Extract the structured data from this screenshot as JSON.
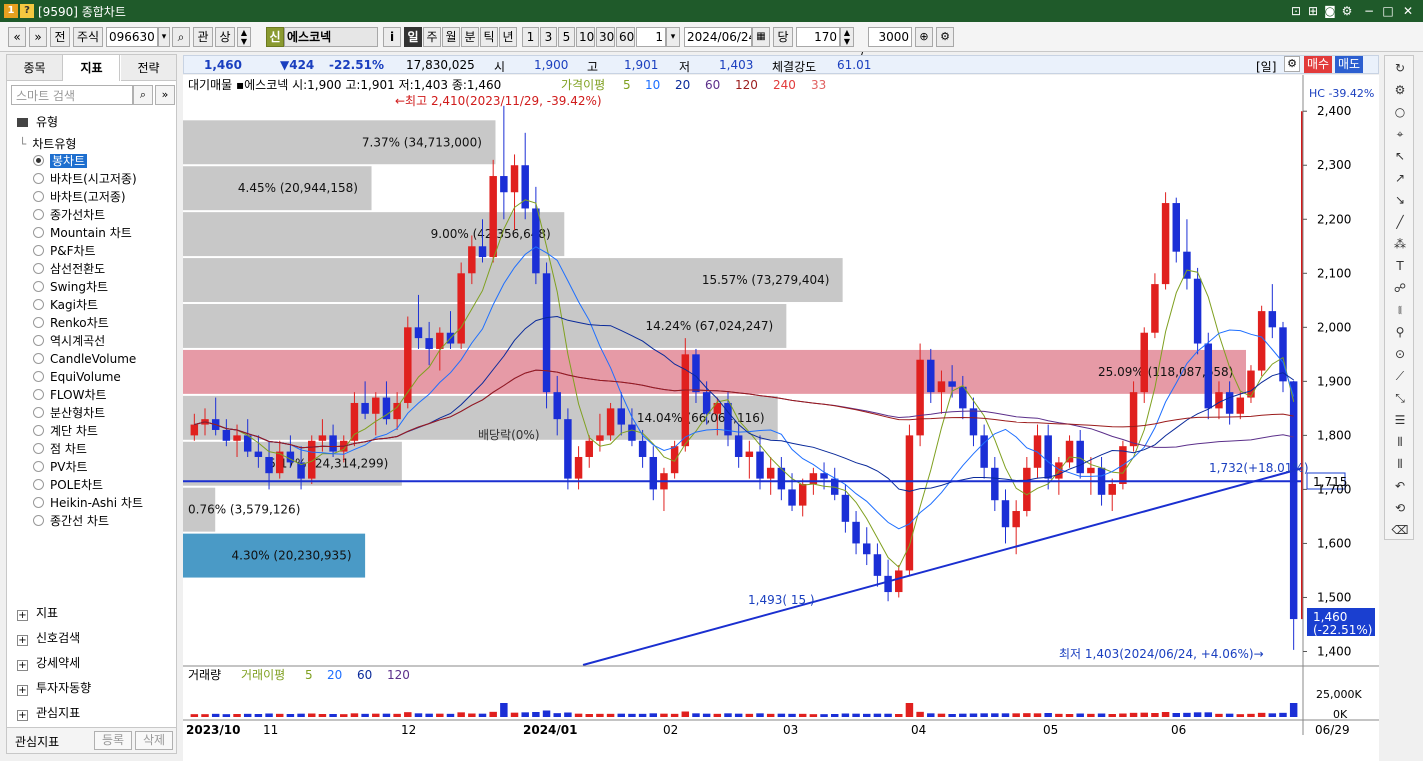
{
  "window": {
    "title": "[9590] 종합차트",
    "icon1": "1",
    "icon2": "?"
  },
  "toolbar": {
    "nav_prev": "«",
    "nav_down": "»",
    "jeon": "전",
    "market": "주식",
    "code": "096630",
    "search_icon": "⌕",
    "gwan": "관",
    "sang": "상",
    "sin_badge": "신",
    "stock_name": "에스코넥",
    "info_btn": "i",
    "periods": [
      "일",
      "주",
      "월",
      "분",
      "틱",
      "년"
    ],
    "selected_period": "일",
    "intervals": [
      "1",
      "3",
      "5",
      "10",
      "30",
      "60"
    ],
    "period_count": "1",
    "date": "2024/06/24",
    "dang": "당",
    "count": "170",
    "slash": "/",
    "total": "3000"
  },
  "left_panel": {
    "tabs": [
      "종목",
      "지표",
      "전략"
    ],
    "selected_tab": "지표",
    "search_placeholder": "스마트 검색",
    "section_type": "유형",
    "chart_type_header": "차트유형",
    "chart_types": [
      "봉차트",
      "바차트(시고저종)",
      "바차트(고저종)",
      "종가선차트",
      "Mountain 차트",
      "P&F차트",
      "삼선전환도",
      "Swing차트",
      "Kagi차트",
      "Renko차트",
      "역시계곡선",
      "CandleVolume",
      "EquiVolume",
      "FLOW차트",
      "분산형차트",
      "계단 차트",
      "점 차트",
      "PV차트",
      "POLE차트",
      "Heikin-Ashi 차트",
      "종간선 차트"
    ],
    "selected_chart_type": "봉차트",
    "sections": [
      "지표",
      "신호검색",
      "강세약세",
      "투자자동향",
      "관심지표"
    ],
    "bottom_label": "관심지표",
    "register_btn": "등록",
    "delete_btn": "삭제"
  },
  "info_bar": {
    "price": "1,460",
    "change": "▼424",
    "change_pct": "-22.51%",
    "volume": "17,830,025",
    "open_label": "시",
    "open": "1,900",
    "high_label": "고",
    "high": "1,901",
    "low_label": "저",
    "low": "1,403",
    "strength_label": "체결강도",
    "strength": "61.01",
    "period_tag": "[일]",
    "buy": "매수",
    "sell": "매도"
  },
  "chart_data": {
    "type": "candlestick",
    "stock": "에스코넥",
    "legend": "대기매물 ▪에스코넥 시:1,900 고:1,901 저:1,403 종:1,460",
    "ma_label": "가격이평",
    "ma_periods": [
      "5",
      "10",
      "20",
      "60",
      "120",
      "240",
      "33"
    ],
    "ma_colors": [
      "#7fa020",
      "#1e6fff",
      "#0a2a9a",
      "#5b2f8a",
      "#9b1b1b",
      "#e23b3b",
      "#e06060"
    ],
    "y_ticks": [
      "2,400",
      "2,300",
      "2,200",
      "2,100",
      "2,000",
      "1,900",
      "1,800",
      "1,700",
      "1,600",
      "1,500",
      "1,400"
    ],
    "ylim": [
      1375,
      2430
    ],
    "x_labels": [
      "2023/10",
      "11",
      "12",
      "2024/01",
      "02",
      "03",
      "04",
      "05",
      "06",
      "06/29"
    ],
    "volume_panel": {
      "label": "거래량",
      "ma_label": "거래이평",
      "ma_periods": [
        "5",
        "20",
        "60",
        "120"
      ],
      "ticks": [
        "25,000K",
        "0K"
      ]
    },
    "annotations": {
      "high": "←최고 2,410(2023/11/29, -39.42%)",
      "low": "최저 1,403(2024/06/24, +4.06%)→",
      "hc": "HC -39.42%",
      "last_price": "1,460",
      "last_pct": "(-22.51%)",
      "line_price": "1,715",
      "trend_label": "1,732(+18.01%)",
      "low_label": "1,493(  15  )",
      "dividend": "배당락(0%)"
    },
    "volume_profile": [
      {
        "pct": "7.37% (34,713,000)",
        "value": 34713000,
        "low": 2300,
        "high": 2385
      },
      {
        "pct": "4.45% (20,944,158)",
        "value": 20944158,
        "low": 2215,
        "high": 2300
      },
      {
        "pct": "9.00% (42,356,648)",
        "value": 42356648,
        "low": 2130,
        "high": 2215
      },
      {
        "pct": "15.57% (73,279,404)",
        "value": 73279404,
        "low": 2045,
        "high": 2130
      },
      {
        "pct": "14.24% (67,024,247)",
        "value": 67024247,
        "low": 1960,
        "high": 2045
      },
      {
        "pct": "25.09% (118,087,658)",
        "value": 118087658,
        "low": 1875,
        "high": 1960
      },
      {
        "pct": "14.04% (66,064,116)",
        "value": 66064116,
        "low": 1790,
        "high": 1875
      },
      {
        "pct": "5.17% (24,314,299)",
        "value": 24314299,
        "low": 1705,
        "high": 1790
      },
      {
        "pct": "0.76% (3,579,126)",
        "value": 3579126,
        "low": 1620,
        "high": 1705
      },
      {
        "pct": "4.30% (20,230,935)",
        "value": 20230935,
        "low": 1535,
        "high": 1620
      }
    ],
    "max_profile_index": 5,
    "current_profile_index": 9,
    "candles": [
      [
        1800,
        1840,
        1790,
        1820
      ],
      [
        1820,
        1850,
        1800,
        1830
      ],
      [
        1830,
        1870,
        1800,
        1810
      ],
      [
        1810,
        1830,
        1780,
        1790
      ],
      [
        1790,
        1820,
        1760,
        1800
      ],
      [
        1800,
        1830,
        1760,
        1770
      ],
      [
        1770,
        1800,
        1740,
        1760
      ],
      [
        1760,
        1790,
        1700,
        1730
      ],
      [
        1730,
        1790,
        1720,
        1770
      ],
      [
        1770,
        1800,
        1740,
        1750
      ],
      [
        1750,
        1780,
        1700,
        1720
      ],
      [
        1720,
        1800,
        1710,
        1790
      ],
      [
        1790,
        1830,
        1770,
        1800
      ],
      [
        1800,
        1820,
        1760,
        1770
      ],
      [
        1770,
        1800,
        1750,
        1790
      ],
      [
        1790,
        1880,
        1780,
        1860
      ],
      [
        1860,
        1900,
        1830,
        1840
      ],
      [
        1840,
        1880,
        1800,
        1870
      ],
      [
        1870,
        1900,
        1820,
        1830
      ],
      [
        1830,
        1880,
        1810,
        1860
      ],
      [
        1860,
        2020,
        1850,
        2000
      ],
      [
        2000,
        2060,
        1960,
        1980
      ],
      [
        1980,
        2010,
        1930,
        1960
      ],
      [
        1960,
        2000,
        1920,
        1990
      ],
      [
        1990,
        2030,
        1960,
        1970
      ],
      [
        1970,
        2120,
        1960,
        2100
      ],
      [
        2100,
        2170,
        2080,
        2150
      ],
      [
        2150,
        2200,
        2120,
        2130
      ],
      [
        2130,
        2310,
        2120,
        2280
      ],
      [
        2280,
        2410,
        2200,
        2250
      ],
      [
        2250,
        2320,
        2180,
        2300
      ],
      [
        2300,
        2360,
        2200,
        2220
      ],
      [
        2220,
        2260,
        2080,
        2100
      ],
      [
        2100,
        2120,
        1850,
        1880
      ],
      [
        1880,
        1910,
        1800,
        1830
      ],
      [
        1830,
        1850,
        1700,
        1720
      ],
      [
        1720,
        1780,
        1700,
        1760
      ],
      [
        1760,
        1800,
        1740,
        1790
      ],
      [
        1790,
        1840,
        1770,
        1800
      ],
      [
        1800,
        1860,
        1790,
        1850
      ],
      [
        1850,
        1880,
        1800,
        1820
      ],
      [
        1820,
        1850,
        1780,
        1790
      ],
      [
        1790,
        1810,
        1740,
        1760
      ],
      [
        1760,
        1780,
        1680,
        1700
      ],
      [
        1700,
        1740,
        1660,
        1730
      ],
      [
        1730,
        1790,
        1720,
        1780
      ],
      [
        1780,
        1980,
        1770,
        1950
      ],
      [
        1950,
        1960,
        1860,
        1880
      ],
      [
        1880,
        1900,
        1820,
        1840
      ],
      [
        1840,
        1870,
        1800,
        1860
      ],
      [
        1860,
        1880,
        1780,
        1800
      ],
      [
        1800,
        1820,
        1740,
        1760
      ],
      [
        1760,
        1790,
        1720,
        1770
      ],
      [
        1770,
        1800,
        1700,
        1720
      ],
      [
        1720,
        1760,
        1690,
        1740
      ],
      [
        1740,
        1760,
        1680,
        1700
      ],
      [
        1700,
        1730,
        1660,
        1670
      ],
      [
        1670,
        1720,
        1650,
        1710
      ],
      [
        1710,
        1740,
        1690,
        1730
      ],
      [
        1730,
        1750,
        1700,
        1720
      ],
      [
        1720,
        1740,
        1680,
        1690
      ],
      [
        1690,
        1710,
        1620,
        1640
      ],
      [
        1640,
        1660,
        1580,
        1600
      ],
      [
        1600,
        1630,
        1560,
        1580
      ],
      [
        1580,
        1600,
        1520,
        1540
      ],
      [
        1540,
        1570,
        1493,
        1510
      ],
      [
        1510,
        1560,
        1500,
        1550
      ],
      [
        1550,
        1820,
        1540,
        1800
      ],
      [
        1800,
        1970,
        1780,
        1940
      ],
      [
        1940,
        1960,
        1860,
        1880
      ],
      [
        1880,
        1920,
        1840,
        1900
      ],
      [
        1900,
        1930,
        1870,
        1890
      ],
      [
        1890,
        1910,
        1830,
        1850
      ],
      [
        1850,
        1870,
        1780,
        1800
      ],
      [
        1800,
        1820,
        1720,
        1740
      ],
      [
        1740,
        1760,
        1660,
        1680
      ],
      [
        1680,
        1700,
        1600,
        1630
      ],
      [
        1630,
        1680,
        1580,
        1660
      ],
      [
        1660,
        1760,
        1650,
        1740
      ],
      [
        1740,
        1820,
        1720,
        1800
      ],
      [
        1800,
        1820,
        1700,
        1720
      ],
      [
        1720,
        1760,
        1690,
        1750
      ],
      [
        1750,
        1800,
        1740,
        1790
      ],
      [
        1790,
        1810,
        1720,
        1730
      ],
      [
        1730,
        1760,
        1690,
        1740
      ],
      [
        1740,
        1760,
        1670,
        1690
      ],
      [
        1690,
        1720,
        1660,
        1710
      ],
      [
        1710,
        1790,
        1700,
        1780
      ],
      [
        1780,
        1900,
        1770,
        1880
      ],
      [
        1880,
        2000,
        1860,
        1990
      ],
      [
        1990,
        2100,
        1980,
        2080
      ],
      [
        2080,
        2250,
        2070,
        2230
      ],
      [
        2230,
        2240,
        2120,
        2140
      ],
      [
        2140,
        2200,
        2070,
        2090
      ],
      [
        2090,
        2110,
        1950,
        1970
      ],
      [
        1970,
        1990,
        1830,
        1850
      ],
      [
        1850,
        1900,
        1830,
        1880
      ],
      [
        1880,
        1900,
        1820,
        1840
      ],
      [
        1840,
        1880,
        1830,
        1870
      ],
      [
        1870,
        1930,
        1860,
        1920
      ],
      [
        1920,
        2040,
        1910,
        2030
      ],
      [
        2030,
        2080,
        1980,
        2000
      ],
      [
        2000,
        2010,
        1880,
        1900
      ],
      [
        1900,
        1901,
        1403,
        1460
      ]
    ]
  }
}
